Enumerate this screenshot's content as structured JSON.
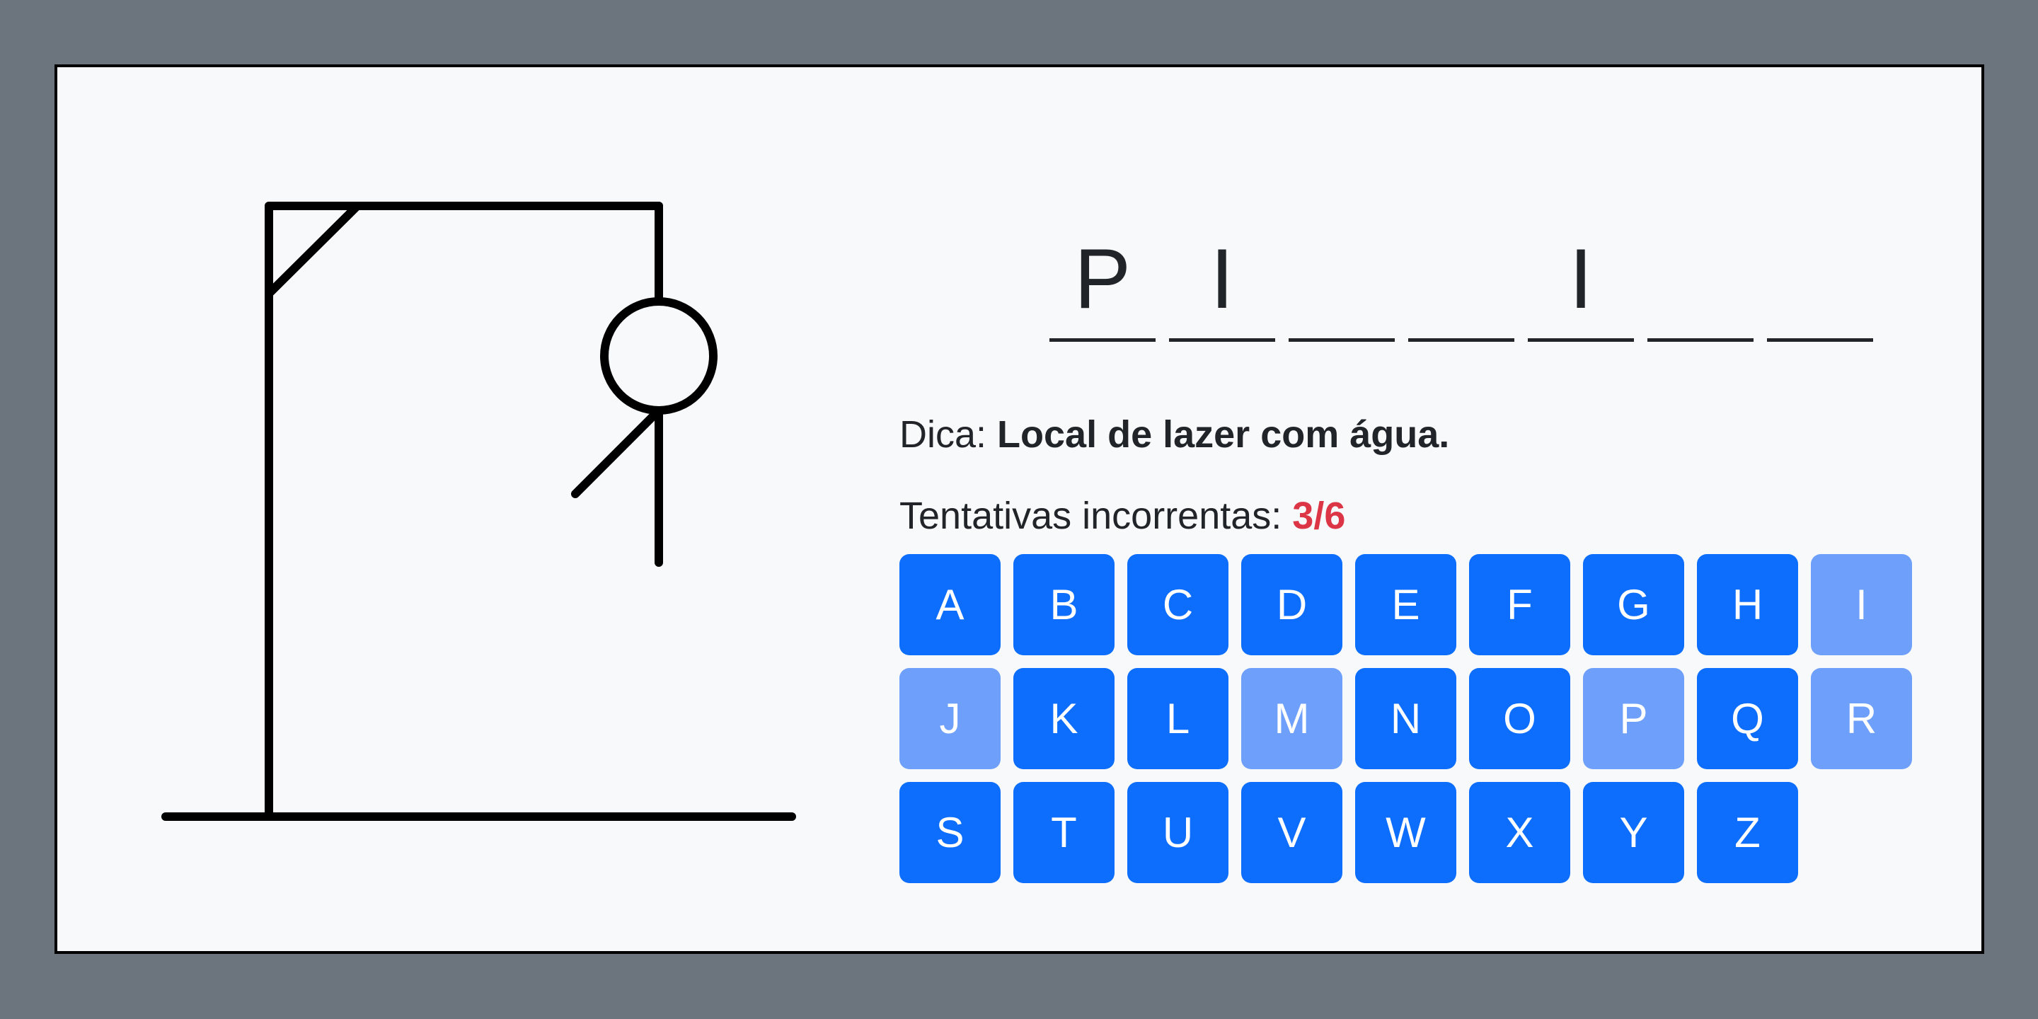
{
  "game": {
    "word_slots": [
      "P",
      "I",
      "",
      "",
      "I",
      "",
      ""
    ],
    "hint_label": "Dica:",
    "hint_text": "Local de lazer com água.",
    "tries_label": "Tentativas incorrentas:",
    "tries_value": "3/6",
    "wrong_guesses": 3,
    "max_guesses": 6
  },
  "keyboard": {
    "keys": [
      {
        "label": "A",
        "used": false
      },
      {
        "label": "B",
        "used": false
      },
      {
        "label": "C",
        "used": false
      },
      {
        "label": "D",
        "used": false
      },
      {
        "label": "E",
        "used": false
      },
      {
        "label": "F",
        "used": false
      },
      {
        "label": "G",
        "used": false
      },
      {
        "label": "H",
        "used": false
      },
      {
        "label": "I",
        "used": true
      },
      {
        "label": "J",
        "used": true
      },
      {
        "label": "K",
        "used": false
      },
      {
        "label": "L",
        "used": false
      },
      {
        "label": "M",
        "used": true
      },
      {
        "label": "N",
        "used": false
      },
      {
        "label": "O",
        "used": false
      },
      {
        "label": "P",
        "used": true
      },
      {
        "label": "Q",
        "used": false
      },
      {
        "label": "R",
        "used": true
      },
      {
        "label": "S",
        "used": false
      },
      {
        "label": "T",
        "used": false
      },
      {
        "label": "U",
        "used": false
      },
      {
        "label": "V",
        "used": false
      },
      {
        "label": "W",
        "used": false
      },
      {
        "label": "X",
        "used": false
      },
      {
        "label": "Y",
        "used": false
      },
      {
        "label": "Z",
        "used": false
      }
    ]
  },
  "colors": {
    "background": "#6c757d",
    "card": "#f8f9fa",
    "key": "#0d6efd",
    "key_used": "#6ea0fb",
    "tries_value": "#dc3545"
  }
}
